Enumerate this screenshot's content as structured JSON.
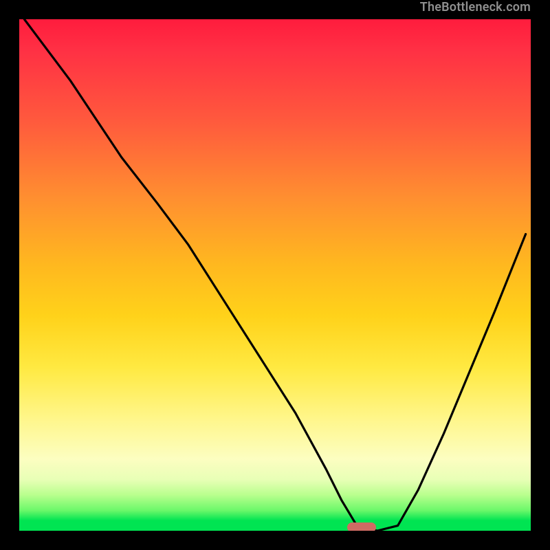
{
  "watermark": "TheBottleneck.com",
  "marker": {
    "x_pct": 67.0,
    "y_pct": 99.3,
    "color": "#cf6b63"
  },
  "chart_data": {
    "type": "line",
    "title": "",
    "xlabel": "",
    "ylabel": "",
    "xlim": [
      0,
      100
    ],
    "ylim": [
      0,
      100
    ],
    "grid": false,
    "series": [
      {
        "name": "curve",
        "color": "#000000",
        "x": [
          1,
          10,
          20,
          27,
          33,
          40,
          47,
          54,
          60,
          63,
          66,
          70,
          74,
          78,
          83,
          88,
          93,
          99
        ],
        "y": [
          100,
          88,
          73,
          64,
          56,
          45,
          34,
          23,
          12,
          6,
          1,
          0,
          1,
          8,
          19,
          31,
          43,
          58
        ]
      }
    ],
    "marker_point": {
      "x": 67,
      "y": 0.7
    }
  }
}
